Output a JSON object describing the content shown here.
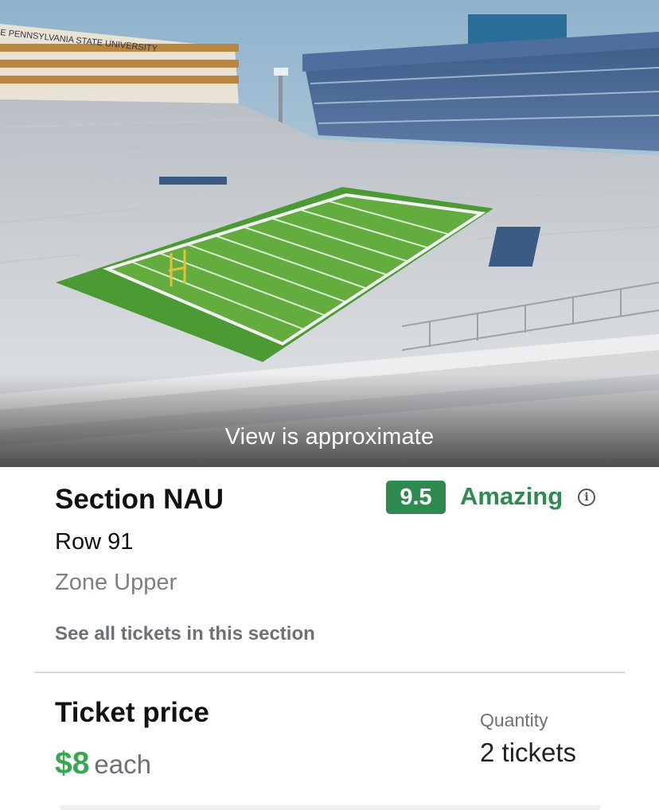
{
  "hero": {
    "banner_text": "E PENNSYLVANIA STATE UNIVERSITY",
    "caption": "View is approximate"
  },
  "listing": {
    "section": "Section NAU",
    "row": "Row 91",
    "zone": "Zone Upper",
    "see_all_link": "See all tickets in this section",
    "rating": {
      "score": "9.5",
      "label": "Amazing",
      "info_icon": "info-icon",
      "color": "#2f8a4f"
    }
  },
  "price": {
    "title": "Ticket price",
    "amount": "$8",
    "unit": "each",
    "amount_color": "#36a84f"
  },
  "quantity": {
    "label": "Quantity",
    "value": "2 tickets"
  }
}
